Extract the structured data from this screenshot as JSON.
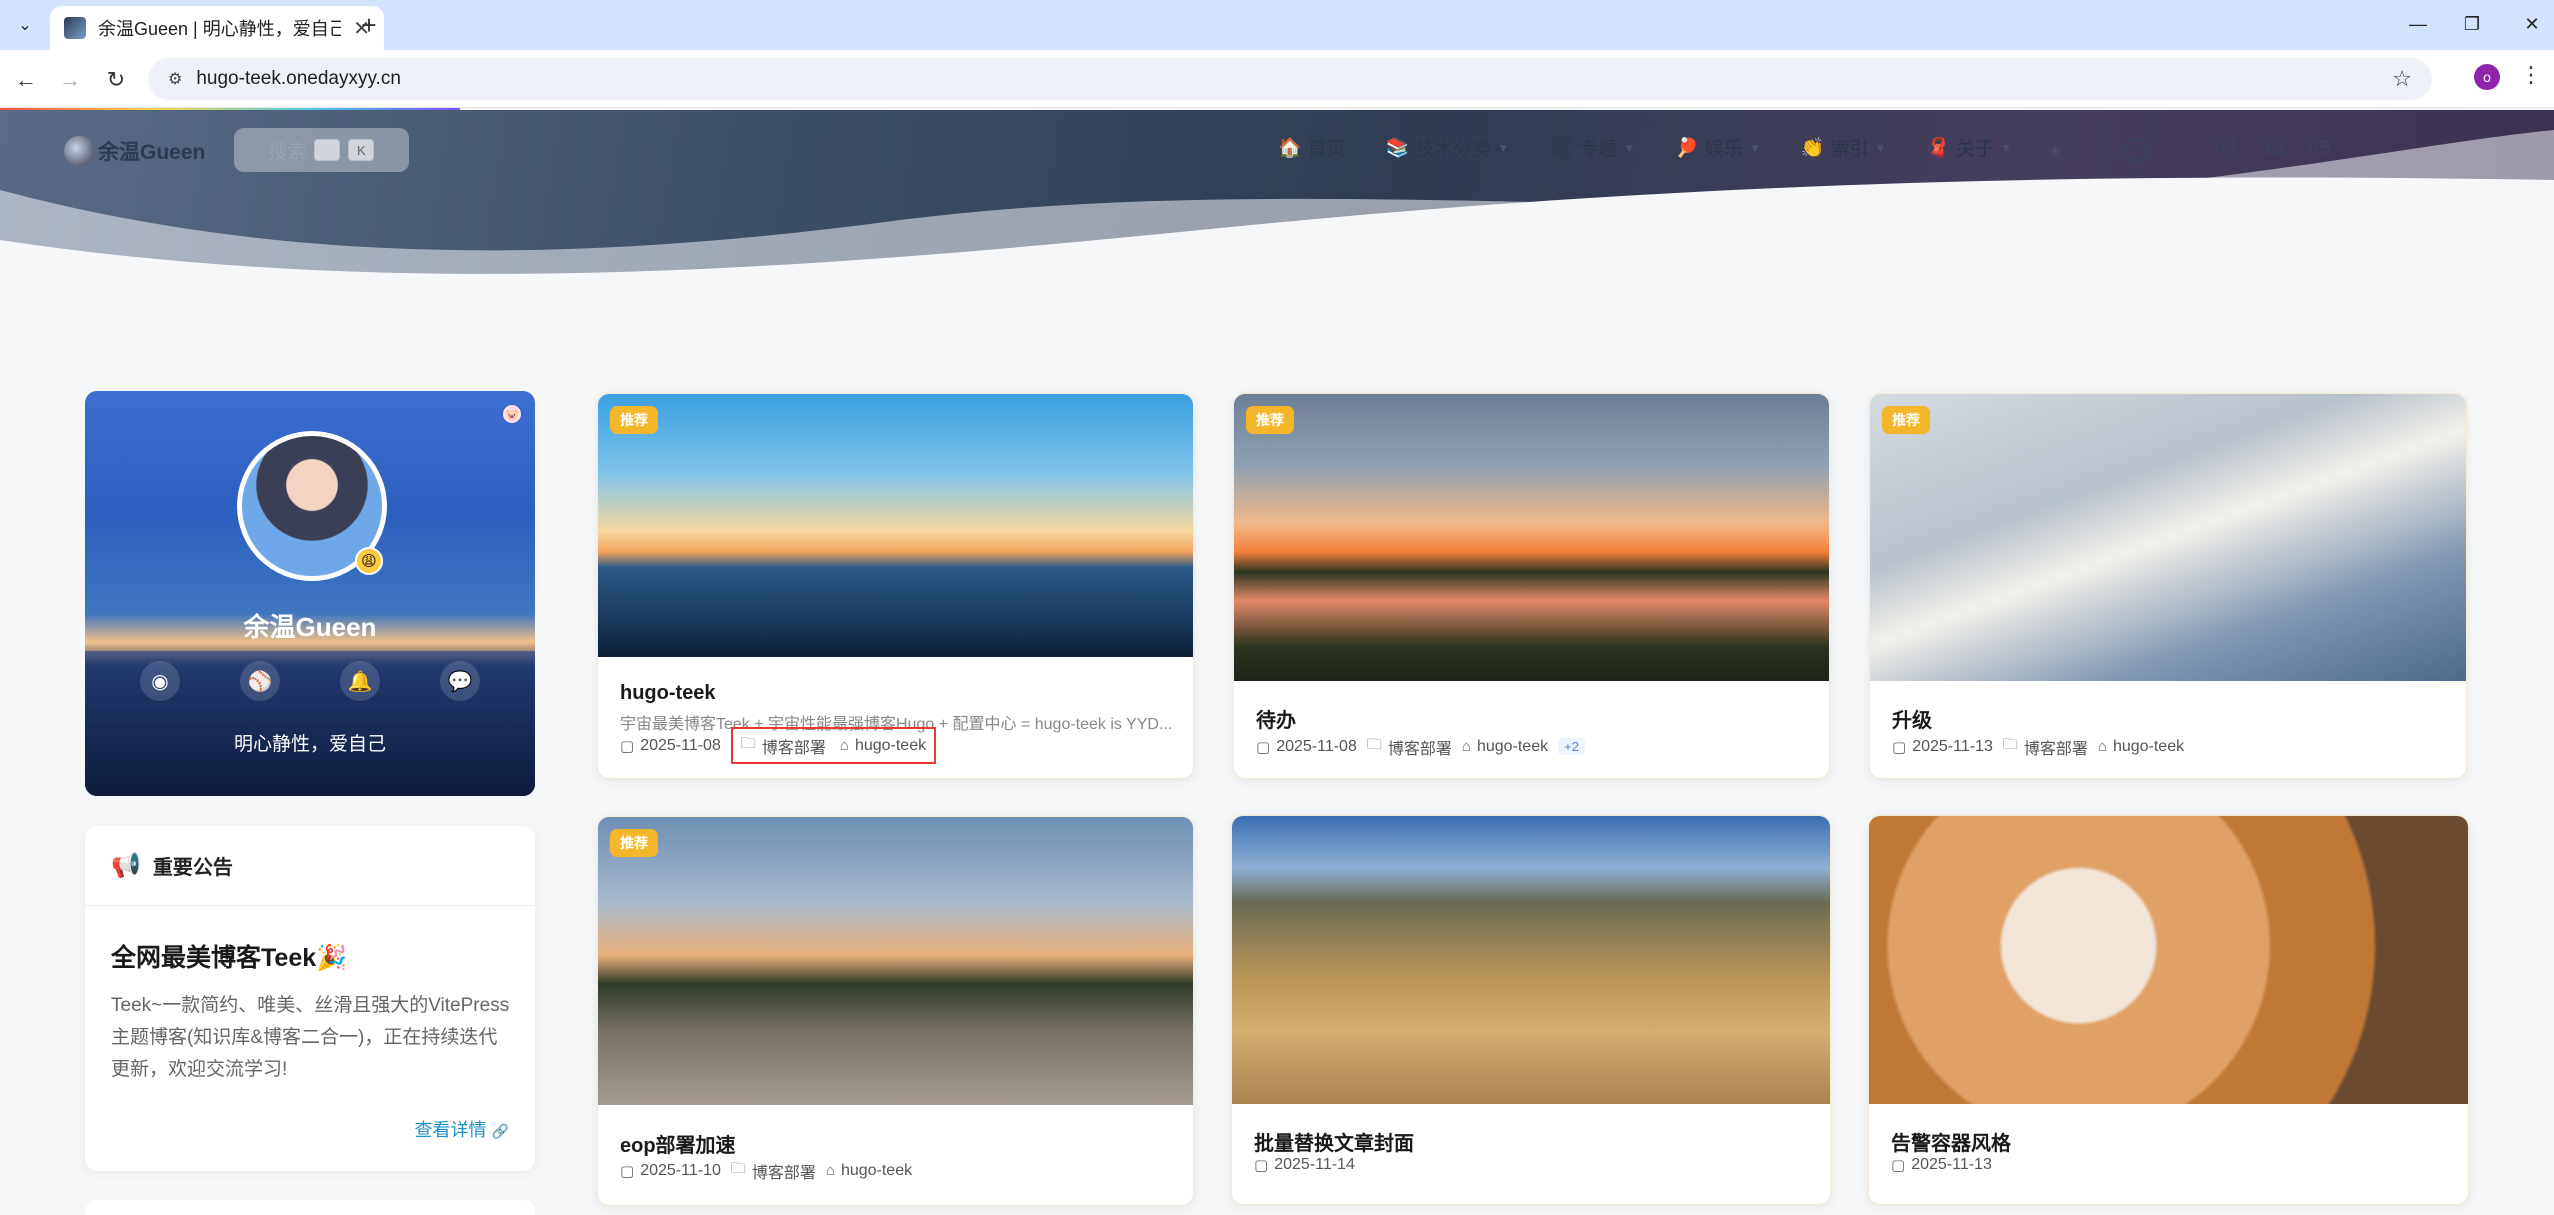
{
  "browser": {
    "tab_title": "余温Gueen | 明心静性，爱自己",
    "url": "hugo-teek.onedayxyy.cn",
    "profile_initial": "o"
  },
  "site": {
    "logo_text": "余温Gueen",
    "search_placeholder": "搜索",
    "search_kbd_1": "",
    "search_kbd_2": "K",
    "nav": [
      {
        "emoji": "🏠",
        "label": "首页"
      },
      {
        "emoji": "📚",
        "label": "技术分类"
      },
      {
        "emoji": "🛠",
        "label": "专题"
      },
      {
        "emoji": "🏓",
        "label": "娱乐"
      },
      {
        "emoji": "👏",
        "label": "索引"
      },
      {
        "emoji": "🧣",
        "label": "关于"
      }
    ],
    "clock": "07 : 32 : 55"
  },
  "profile_card": {
    "name": "余温Gueen",
    "motto": "明心静性，爱自己",
    "badge_emoji": "😩"
  },
  "notice": {
    "heading": "重要公告",
    "title": "全网最美博客Teek🎉",
    "body": "Teek~一款简约、唯美、丝滑且强大的VitePress主题博客(知识库&博客二合一)，正在持续迭代更新，欢迎交流学习!",
    "link": "查看详情"
  },
  "posts": [
    {
      "badge": "推荐",
      "title": "hugo-teek",
      "desc": "宇宙最美博客Teek + 宇宙性能最强博客Hugo + 配置中心 = hugo-teek is YYD...",
      "date": "2025-11-08",
      "category": "博客部署",
      "tag": "hugo-teek",
      "more": ""
    },
    {
      "badge": "推荐",
      "title": "待办",
      "desc": "",
      "date": "2025-11-08",
      "category": "博客部署",
      "tag": "hugo-teek",
      "more": "+2"
    },
    {
      "badge": "推荐",
      "title": "升级",
      "desc": "",
      "date": "2025-11-13",
      "category": "博客部署",
      "tag": "hugo-teek",
      "more": ""
    },
    {
      "badge": "推荐",
      "title": "eop部署加速",
      "desc": "",
      "date": "2025-11-10",
      "category": "博客部署",
      "tag": "hugo-teek",
      "more": ""
    },
    {
      "badge": "",
      "title": "批量替换文章封面",
      "desc": "",
      "date": "2025-11-14",
      "category": "",
      "tag": "",
      "more": ""
    },
    {
      "badge": "",
      "title": "告警容器风格",
      "desc": "",
      "date": "2025-11-13",
      "category": "",
      "tag": "",
      "more": ""
    }
  ]
}
